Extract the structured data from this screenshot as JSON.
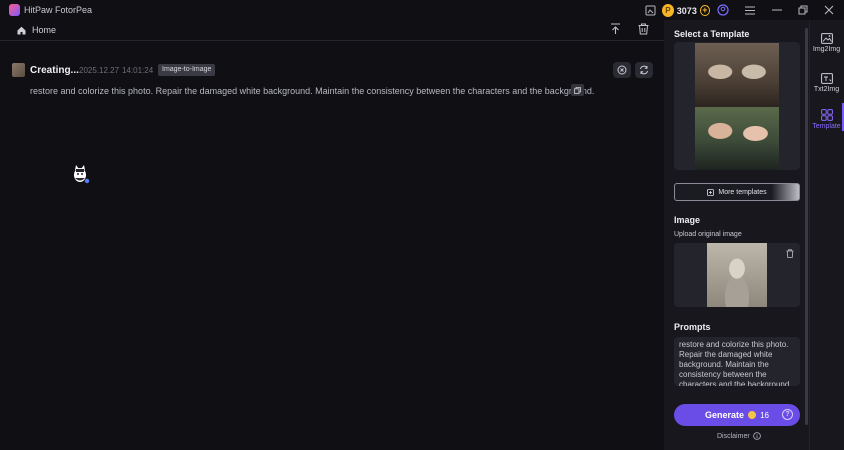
{
  "app": {
    "title": "HitPaw FotorPea",
    "coins": "3073",
    "coin_symbol": "P"
  },
  "header": {
    "home_label": "Home"
  },
  "task": {
    "title": "Creating...",
    "date": "2025.12.27",
    "time": "14:01:24",
    "badge": "Image-to-Image",
    "prompt": "restore and colorize this photo. Repair the damaged white background. Maintain the consistency between the characters and the background."
  },
  "panel": {
    "template_heading": "Select a Template",
    "more_templates_label": "More templates",
    "image_heading": "Image",
    "upload_label": "Upload original image",
    "prompts_heading": "Prompts",
    "prompt_text": "restore and colorize this photo. Repair the damaged white background. Maintain the consistency between the characters and the background.",
    "generate_label": "Generate",
    "generate_cost": "16",
    "disclaimer_label": "Disclaimer"
  },
  "sidenav": {
    "items": [
      {
        "label": "Img2Img"
      },
      {
        "label": "Txt2Img"
      },
      {
        "label": "Template"
      }
    ]
  },
  "colors": {
    "accent": "#6a4de6",
    "background": "#0f0f14",
    "panel": "#17171d",
    "coin": "#f5b524"
  }
}
